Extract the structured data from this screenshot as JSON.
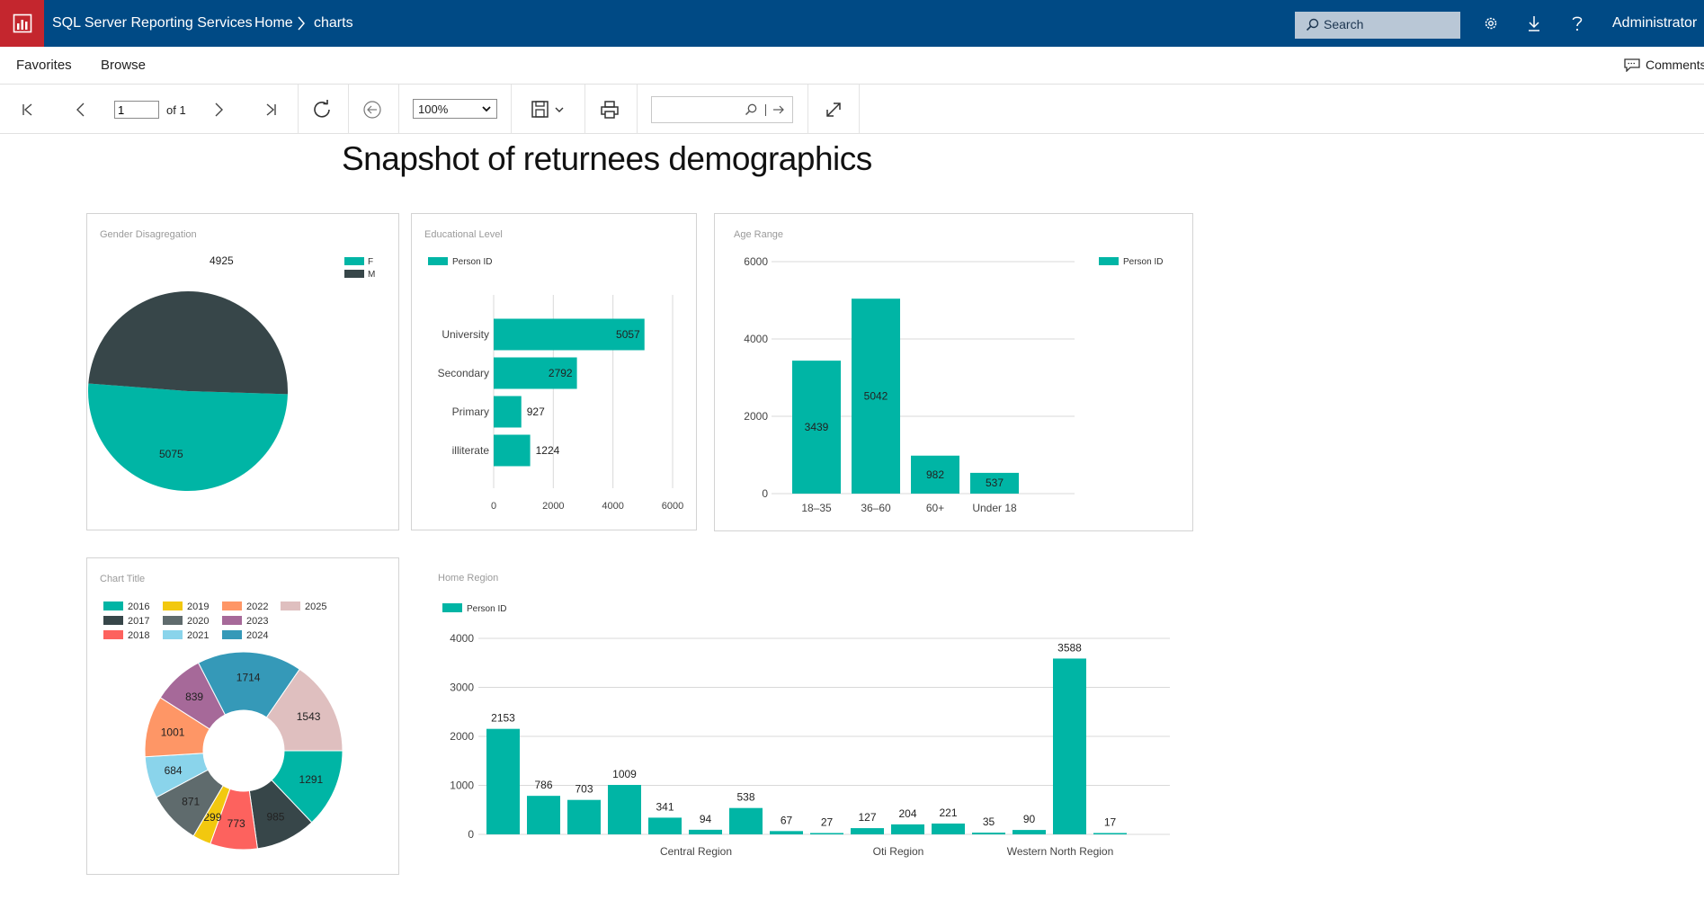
{
  "app": {
    "title": "SQL Server Reporting Services",
    "breadcrumb_home": "Home",
    "breadcrumb_current": "charts",
    "search_placeholder": "Search",
    "user": "Administrator"
  },
  "nav": {
    "favorites": "Favorites",
    "browse": "Browse",
    "comments": "Comments"
  },
  "toolbar": {
    "page_value": "1",
    "page_of": "of 1",
    "zoom": "100%"
  },
  "report": {
    "title": "Snapshot of returnees demographics"
  },
  "colors": {
    "teal": "#00b5a5",
    "dark": "#374649",
    "header": "#004a85",
    "logo": "#c4262e"
  },
  "chart_data": [
    {
      "id": "gender",
      "type": "pie",
      "title": "Gender Disagregation",
      "categories": [
        "F",
        "M"
      ],
      "values": [
        5075,
        4925
      ],
      "colors": [
        "#00b5a5",
        "#374649"
      ],
      "legend": "top-right"
    },
    {
      "id": "education",
      "type": "bar",
      "orientation": "horizontal",
      "title": "Educational Level",
      "categories": [
        "University",
        "Secondary",
        "Primary",
        "illiterate"
      ],
      "series": [
        {
          "name": "Person ID",
          "values": [
            5057,
            2792,
            927,
            1224
          ]
        }
      ],
      "xlim": [
        0,
        6000
      ],
      "ticks": [
        "0",
        "2000",
        "4000",
        "6000"
      ],
      "grid": true,
      "legend": "top-left"
    },
    {
      "id": "age",
      "type": "bar",
      "title": "Age Range",
      "categories": [
        "18–35",
        "36–60",
        "60+",
        "Under 18"
      ],
      "series": [
        {
          "name": "Person ID",
          "values": [
            3439,
            5042,
            982,
            537
          ]
        }
      ],
      "ylim": [
        0,
        6000
      ],
      "ticks": [
        "0",
        "2000",
        "4000",
        "6000"
      ],
      "grid": true,
      "legend": "top-right"
    },
    {
      "id": "year",
      "type": "pie",
      "donut": true,
      "title": "Chart Title",
      "categories": [
        "2016",
        "2017",
        "2018",
        "2019",
        "2020",
        "2021",
        "2022",
        "2023",
        "2024",
        "2025"
      ],
      "values": [
        1291,
        985,
        773,
        299,
        871,
        684,
        1001,
        839,
        1714,
        1543
      ],
      "colors": [
        "#00b5a5",
        "#374649",
        "#fd625e",
        "#f2c80f",
        "#5f6b6d",
        "#8ad4eb",
        "#fe9666",
        "#a66999",
        "#3599b8",
        "#dfbfbf"
      ],
      "legend": "top-left"
    },
    {
      "id": "region",
      "type": "bar",
      "title": "Home Region",
      "series": [
        {
          "name": "Person ID",
          "values": [
            2153,
            786,
            703,
            1009,
            341,
            94,
            538,
            67,
            27,
            127,
            204,
            221,
            35,
            90,
            3588,
            17
          ]
        }
      ],
      "axis_labels": [
        "Central Region",
        "Oti Region",
        "Western North Region"
      ],
      "ylim": [
        0,
        4000
      ],
      "ticks": [
        "0",
        "1000",
        "2000",
        "3000",
        "4000"
      ],
      "grid": true,
      "legend": "top-left"
    }
  ]
}
